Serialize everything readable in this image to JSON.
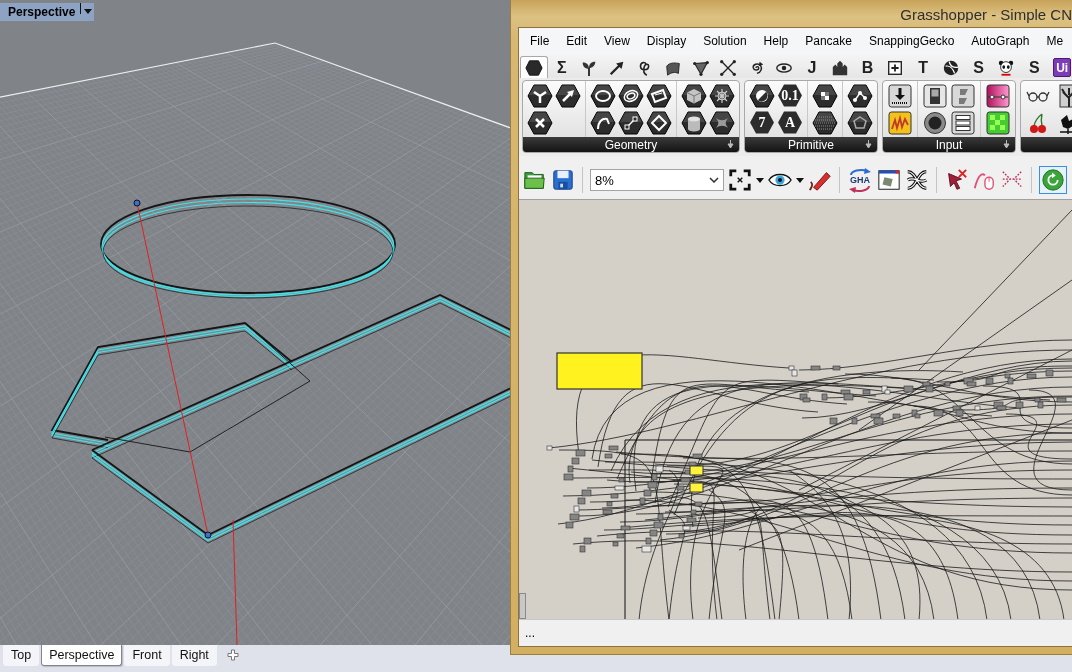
{
  "viewport": {
    "label": "Perspective"
  },
  "viewport_tabs": [
    {
      "label": "Top",
      "selected": false
    },
    {
      "label": "Perspective",
      "selected": true
    },
    {
      "label": "Front",
      "selected": false
    },
    {
      "label": "Right",
      "selected": false
    }
  ],
  "grasshopper": {
    "title": "Grasshopper - Simple CN",
    "menu": [
      "File",
      "Edit",
      "View",
      "Display",
      "Solution",
      "Help",
      "Pancake",
      "SnappingGecko",
      "AutoGraph",
      "Me"
    ],
    "component_tabs": [
      {
        "kind": "icon",
        "selected": true
      },
      {
        "kind": "glyph",
        "text": "Σ",
        "selected": false
      },
      {
        "kind": "icon",
        "selected": false
      },
      {
        "kind": "icon",
        "selected": false
      },
      {
        "kind": "icon",
        "selected": false
      },
      {
        "kind": "icon",
        "selected": false
      },
      {
        "kind": "icon",
        "selected": false
      },
      {
        "kind": "icon",
        "selected": false
      },
      {
        "kind": "icon",
        "selected": false
      },
      {
        "kind": "icon",
        "selected": false
      },
      {
        "kind": "glyph",
        "text": "J",
        "selected": false
      },
      {
        "kind": "icon",
        "selected": false
      },
      {
        "kind": "glyph",
        "text": "B",
        "selected": false
      },
      {
        "kind": "icon",
        "selected": false
      },
      {
        "kind": "glyph",
        "text": "T",
        "selected": false
      },
      {
        "kind": "icon",
        "selected": false
      },
      {
        "kind": "glyph",
        "text": "S",
        "selected": false
      },
      {
        "kind": "icon",
        "selected": false
      },
      {
        "kind": "glyph",
        "text": "S",
        "selected": false
      },
      {
        "kind": "tile",
        "text": "Ui",
        "selected": false
      }
    ],
    "ribbon_panels": [
      {
        "title": "Geometry",
        "groups": [
          [
            {
              "kind": "icon"
            },
            {
              "kind": "icon"
            },
            {
              "kind": "icon"
            }
          ],
          [
            {
              "kind": "icon"
            },
            {
              "kind": "icon"
            },
            {
              "kind": "icon"
            },
            {
              "kind": "icon"
            },
            {
              "kind": "icon"
            },
            {
              "kind": "icon"
            }
          ],
          [
            {
              "kind": "icon"
            },
            {
              "kind": "icon"
            },
            {
              "kind": "icon"
            },
            {
              "kind": "icon"
            }
          ]
        ]
      },
      {
        "title": "Primitive",
        "groups": [
          [
            {
              "kind": "icon"
            },
            {
              "kind": "glyph",
              "text": "7"
            },
            {
              "kind": "glyph",
              "text": "0.1"
            },
            {
              "kind": "glyph",
              "text": "A"
            }
          ],
          [
            {
              "kind": "icon"
            },
            {
              "kind": "icon"
            }
          ],
          [
            {
              "kind": "icon"
            },
            {
              "kind": "icon"
            }
          ]
        ]
      },
      {
        "title": "Input",
        "groups": [
          [
            {
              "kind": "icon"
            },
            {
              "kind": "icon"
            }
          ],
          [
            {
              "kind": "icon"
            },
            {
              "kind": "icon"
            },
            {
              "kind": "icon"
            },
            {
              "kind": "icon"
            }
          ],
          [
            {
              "kind": "icon"
            },
            {
              "kind": "icon"
            }
          ]
        ]
      },
      {
        "groups": [
          [
            {
              "kind": "icon"
            },
            {
              "kind": "icon"
            },
            {
              "kind": "icon"
            },
            {
              "kind": "icon"
            }
          ]
        ]
      }
    ],
    "canvas_toolbar": {
      "zoom": "8%",
      "gha_label": "GHA",
      "solver_toggle": {
        "on": true
      }
    },
    "status_text": "..."
  }
}
